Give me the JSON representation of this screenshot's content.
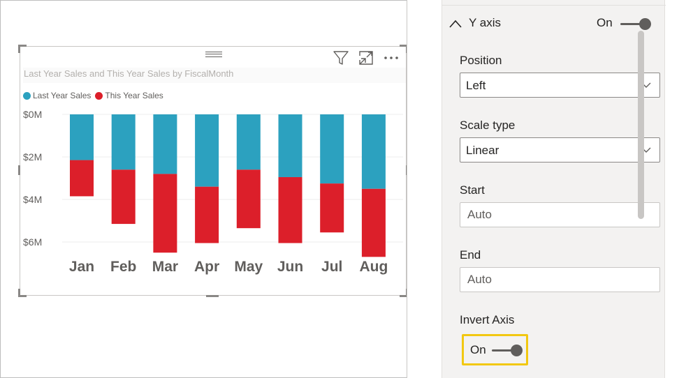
{
  "chart_data": {
    "type": "bar",
    "title": "Last Year Sales and This Year Sales by FiscalMonth",
    "categories": [
      "Jan",
      "Feb",
      "Mar",
      "Apr",
      "May",
      "Jun",
      "Jul",
      "Aug"
    ],
    "series": [
      {
        "name": "Last Year Sales",
        "color": "#2ca1bf",
        "values": [
          2.15,
          2.6,
          2.8,
          3.4,
          2.6,
          2.95,
          3.25,
          3.5
        ]
      },
      {
        "name": "This Year Sales",
        "color": "#dc1f2a",
        "values": [
          1.7,
          2.55,
          3.7,
          2.65,
          2.75,
          3.1,
          2.3,
          3.2
        ]
      }
    ],
    "stacked": true,
    "y_axis": {
      "ticks": [
        0,
        2,
        4,
        6
      ],
      "tick_labels": [
        "$0M",
        "$2M",
        "$4M",
        "$6M"
      ],
      "ylim": [
        0,
        7.5
      ],
      "inverted": true,
      "position": "left"
    },
    "grid": true,
    "legend_position": "top-left"
  },
  "visual": {
    "icons": [
      "filter-icon",
      "focus-mode-icon",
      "more-options-icon"
    ]
  },
  "pane": {
    "section_title": "Y axis",
    "section_toggle": "On",
    "fields": {
      "position_label": "Position",
      "position_value": "Left",
      "scale_label": "Scale type",
      "scale_value": "Linear",
      "start_label": "Start",
      "start_placeholder": "Auto",
      "end_label": "End",
      "end_placeholder": "Auto",
      "invert_label": "Invert Axis",
      "invert_value": "On"
    },
    "highlight_color": "#f2c811"
  }
}
